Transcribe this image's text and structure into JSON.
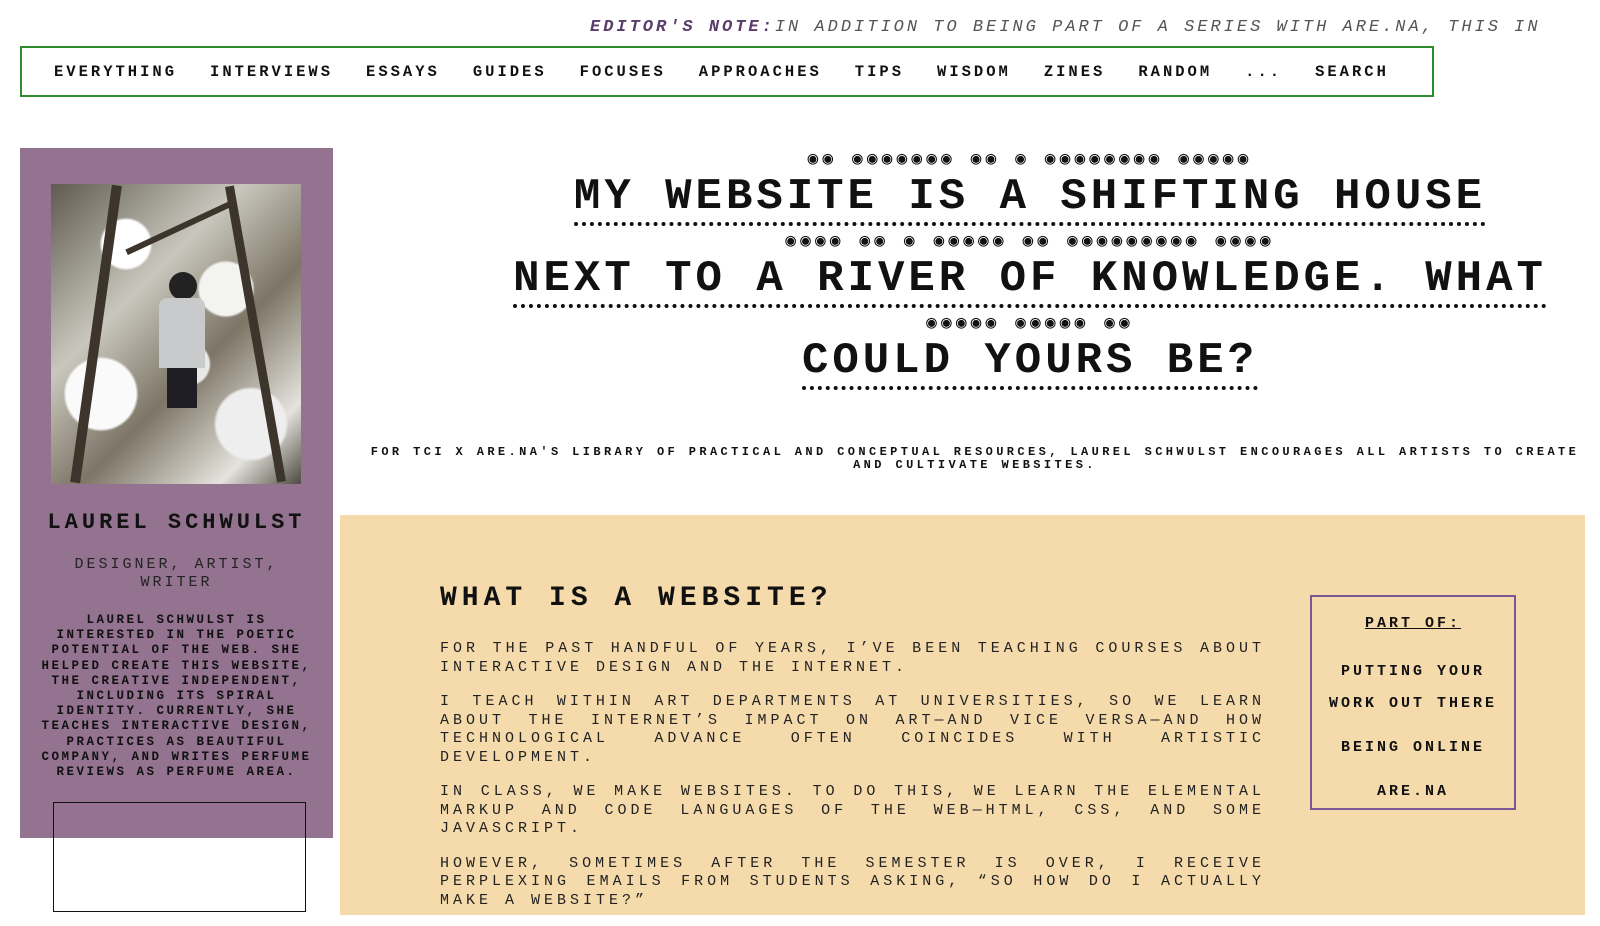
{
  "ticker": {
    "label": "EDITOR'S NOTE:",
    "text": "IN ADDITION TO BEING PART OF A SERIES WITH ARE.NA, THIS IN"
  },
  "nav": {
    "items": [
      "EVERYTHING",
      "INTERVIEWS",
      "ESSAYS",
      "GUIDES",
      "FOCUSES",
      "APPROACHES",
      "TIPS",
      "WISDOM",
      "ZINES",
      "RANDOM",
      "...",
      "SEARCH"
    ]
  },
  "sidebar": {
    "author_name": "LAUREL SCHWULST",
    "author_role": "DESIGNER, ARTIST, WRITER",
    "author_bio": "LAUREL SCHWULST IS INTERESTED IN THE POETIC POTENTIAL OF THE WEB. SHE HELPED CREATE THIS WEBSITE, THE CREATIVE INDEPENDENT, INCLUDING ITS SPIRAL IDENTITY. CURRENTLY, SHE TEACHES INTERACTIVE DESIGN, PRACTICES AS BEAUTIFUL COMPANY, AND WRITES PERFUME REVIEWS AS PERFUME AREA."
  },
  "title": {
    "line1": "MY WEBSITE IS A SHIFTING HOUSE",
    "line2": "NEXT TO A RIVER OF KNOWLEDGE. WHAT",
    "line3": "COULD YOURS BE?",
    "dots1": "◉◉ ◉◉◉◉◉◉◉ ◉◉ ◉ ◉◉◉◉◉◉◉◉ ◉◉◉◉◉",
    "dots2": "◉◉◉◉ ◉◉ ◉ ◉◉◉◉◉ ◉◉ ◉◉◉◉◉◉◉◉◉ ◉◉◉◉",
    "dots3": "◉◉◉◉◉ ◉◉◉◉◉ ◉◉"
  },
  "subtitle": "FOR TCI X ARE.NA'S LIBRARY OF PRACTICAL AND CONCEPTUAL RESOURCES, LAUREL SCHWULST ENCOURAGES ALL ARTISTS TO CREATE AND CULTIVATE WEBSITES.",
  "article": {
    "heading": "WHAT IS A WEBSITE?",
    "paragraphs": [
      "FOR THE PAST HANDFUL OF YEARS, I’VE BEEN TEACHING COURSES ABOUT INTERACTIVE DESIGN AND THE INTERNET.",
      "I TEACH WITHIN ART DEPARTMENTS AT UNIVERSITIES, SO WE LEARN ABOUT THE INTERNET’S IMPACT ON ART—AND VICE VERSA—AND HOW TECHNOLOGICAL ADVANCE OFTEN COINCIDES WITH ARTISTIC DEVELOPMENT.",
      "IN CLASS, WE MAKE WEBSITES. TO DO THIS, WE LEARN THE ELEMENTAL MARKUP AND CODE LANGUAGES OF THE WEB—HTML, CSS, AND SOME JAVASCRIPT.",
      "HOWEVER, SOMETIMES AFTER THE SEMESTER IS OVER, I RECEIVE PERPLEXING EMAILS FROM STUDENTS ASKING, “SO HOW DO I ACTUALLY MAKE A WEBSITE?”"
    ]
  },
  "part_of": {
    "title": "PART OF:",
    "links": [
      "PUTTING YOUR WORK OUT THERE",
      "BEING ONLINE",
      "ARE.NA"
    ]
  },
  "colors": {
    "sidebar_bg": "#93738f",
    "content_bg": "#f5dbab",
    "nav_border": "#2e8b2e",
    "partof_border": "#7b5793"
  }
}
